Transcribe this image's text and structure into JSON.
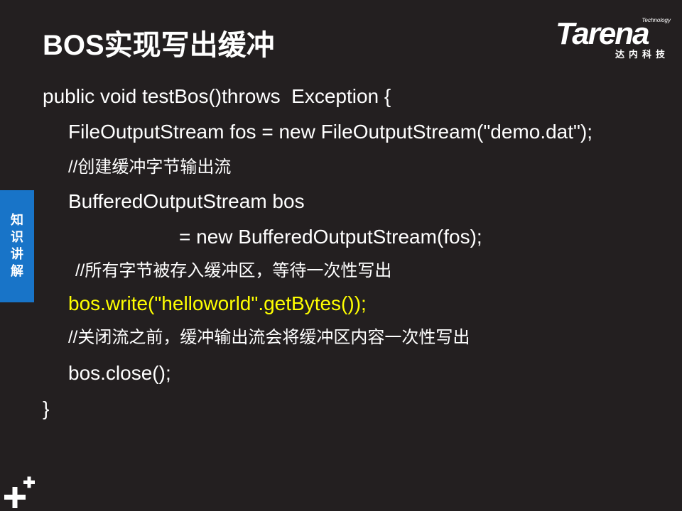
{
  "slide": {
    "title": "BOS实现写出缓冲",
    "logo": {
      "sub": "Technology",
      "main": "Tarena",
      "cn": "达内科技"
    },
    "side_tab": {
      "chars": [
        "知",
        "识",
        "讲",
        "解"
      ]
    },
    "code_lines": [
      "public void testBos()throws  Exception {",
      "FileOutputStream fos = new FileOutputStream(\"demo.dat\");",
      "//创建缓冲字节输出流",
      "BufferedOutputStream bos",
      "= new BufferedOutputStream(fos);",
      "//所有字节被存入缓冲区，等待一次性写出",
      "bos.write(\"helloworld\".getBytes());",
      "//关闭流之前，缓冲输出流会将缓冲区内容一次性写出",
      "bos.close();",
      "}"
    ],
    "colors": {
      "background": "#231f20",
      "text": "#ffffff",
      "highlight": "#ffff00",
      "side_tab": "#1874c8"
    }
  }
}
